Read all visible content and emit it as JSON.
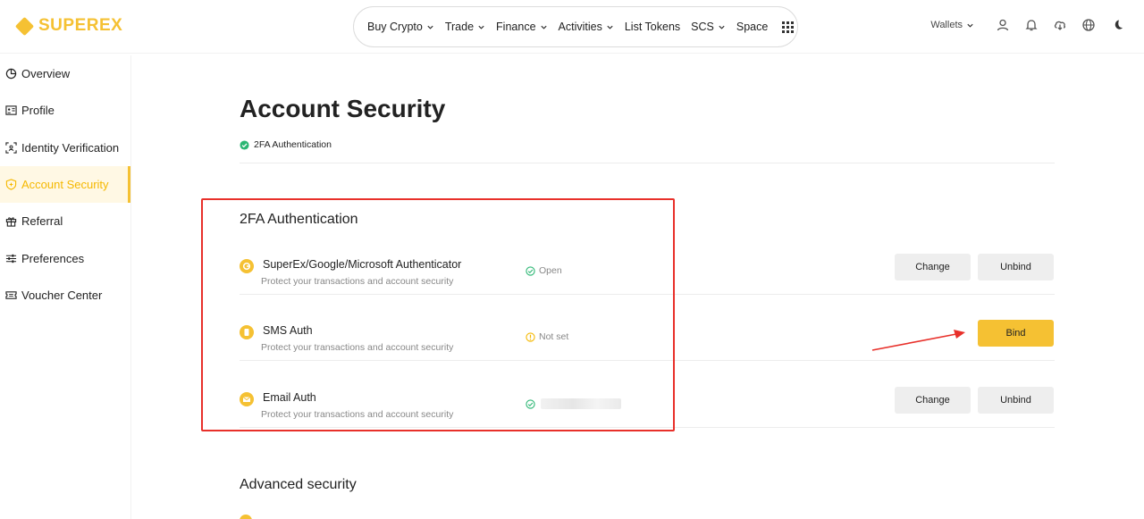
{
  "brand": {
    "name": "SUPEREX",
    "accent": "#f5c133"
  },
  "nav": {
    "items": [
      {
        "label": "Buy Crypto",
        "dropdown": true
      },
      {
        "label": "Trade",
        "dropdown": true
      },
      {
        "label": "Finance",
        "dropdown": true
      },
      {
        "label": "Activities",
        "dropdown": true
      },
      {
        "label": "List Tokens",
        "dropdown": false
      },
      {
        "label": "SCS",
        "dropdown": true
      },
      {
        "label": "Space",
        "dropdown": false
      }
    ],
    "more_icon": "apps-grid-icon"
  },
  "header_right": {
    "wallets_label": "Wallets",
    "icons": [
      "user-icon",
      "bell-icon",
      "download-cloud-icon",
      "globe-icon",
      "moon-icon"
    ]
  },
  "sidebar": {
    "items": [
      {
        "label": "Overview",
        "icon": "pie-chart-icon",
        "active": false
      },
      {
        "label": "Profile",
        "icon": "id-card-icon",
        "active": false
      },
      {
        "label": "Identity Verification",
        "icon": "scan-face-icon",
        "active": false
      },
      {
        "label": "Account Security",
        "icon": "shield-icon",
        "active": true
      },
      {
        "label": "Referral",
        "icon": "gift-icon",
        "active": false
      },
      {
        "label": "Preferences",
        "icon": "sliders-icon",
        "active": false
      },
      {
        "label": "Voucher Center",
        "icon": "ticket-icon",
        "active": false
      }
    ]
  },
  "page": {
    "title": "Account Security",
    "chip_label": "2FA Authentication"
  },
  "tfa_section": {
    "title": "2FA Authentication",
    "rows": [
      {
        "name": "SuperEx/Google/Microsoft Authenticator",
        "desc": "Protect your transactions and account security",
        "status": "Open",
        "status_type": "ok",
        "buttons": [
          "Change",
          "Unbind"
        ]
      },
      {
        "name": "SMS Auth",
        "desc": "Protect your transactions and account security",
        "status": "Not set",
        "status_type": "warn",
        "buttons": [
          "Bind"
        ]
      },
      {
        "name": "Email Auth",
        "desc": "Protect your transactions and account security",
        "status": "",
        "status_type": "ok-masked",
        "buttons": [
          "Change",
          "Unbind"
        ]
      }
    ]
  },
  "advanced_section": {
    "title": "Advanced security"
  },
  "colors": {
    "ok": "#2bb673",
    "warn": "#f5b800",
    "annotation": "#e8302a"
  }
}
